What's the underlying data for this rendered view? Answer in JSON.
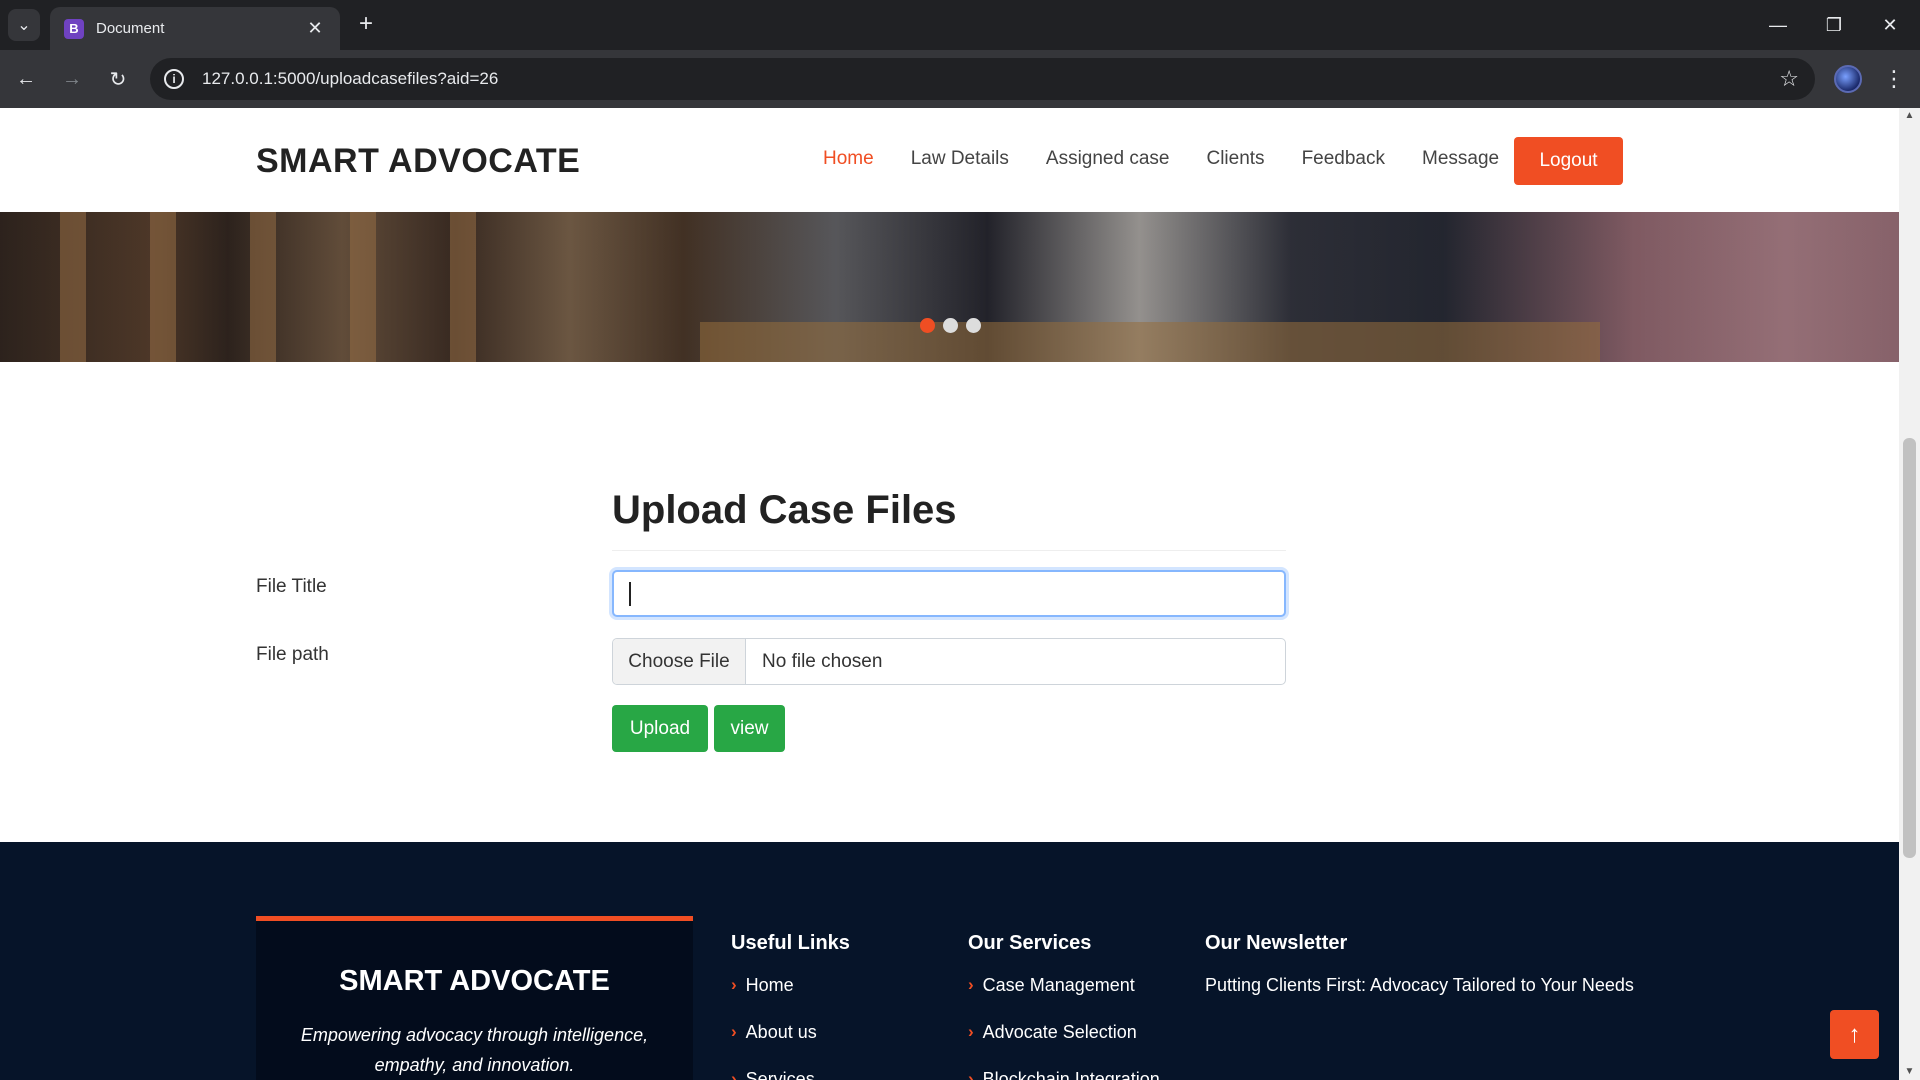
{
  "browser": {
    "tab_title": "Document",
    "favicon_letter": "B",
    "url": "127.0.0.1:5000/uploadcasefiles?aid=26"
  },
  "header": {
    "brand": "SMART ADVOCATE",
    "nav": {
      "home": "Home",
      "law_details": "Law Details",
      "assigned_case": "Assigned case",
      "clients": "Clients",
      "feedback": "Feedback",
      "message": "Message"
    },
    "logout": "Logout"
  },
  "carousel": {
    "slide_count": 3,
    "active_index": 0
  },
  "form": {
    "title": "Upload Case Files",
    "file_title_label": "File Title",
    "file_title_value": "",
    "file_path_label": "File path",
    "choose_file": "Choose File",
    "no_file": "No file chosen",
    "upload": "Upload",
    "view": "view"
  },
  "footer": {
    "brand": "SMART ADVOCATE",
    "tagline": "Empowering advocacy through intelligence, empathy, and innovation.",
    "useful_links": {
      "heading": "Useful Links",
      "items": [
        "Home",
        "About us",
        "Services"
      ]
    },
    "our_services": {
      "heading": "Our Services",
      "items": [
        "Case Management",
        "Advocate Selection",
        "Blockchain Integration"
      ]
    },
    "newsletter": {
      "heading": "Our Newsletter",
      "text": "Putting Clients First: Advocacy Tailored to Your Needs"
    }
  },
  "colors": {
    "accent": "#f04e23",
    "success": "#28a745",
    "footer_bg": "#061429"
  }
}
